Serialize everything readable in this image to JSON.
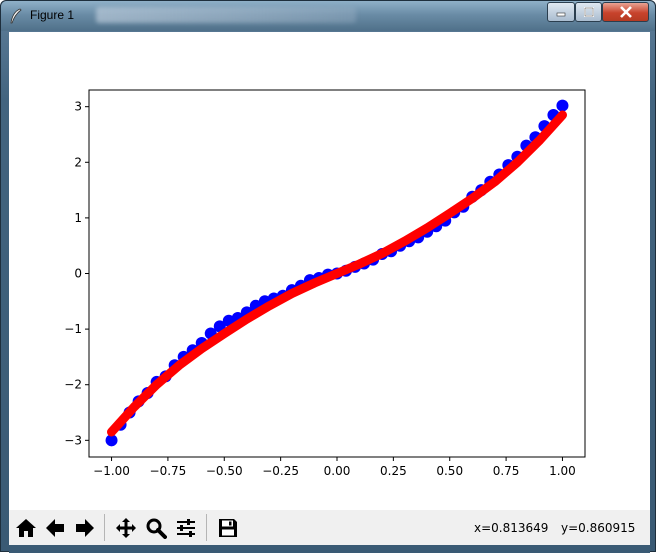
{
  "window": {
    "title": "Figure 1"
  },
  "toolbar": {
    "buttons": [
      "home-icon",
      "back-arrow-icon",
      "forward-arrow-icon",
      "pan-icon",
      "zoom-icon",
      "configure-subplots-icon",
      "save-icon"
    ],
    "coord_x": "x=0.813649",
    "coord_y": "y=0.860915"
  },
  "colors": {
    "scatter": "#0000ff",
    "fit": "#ff0000"
  },
  "chart_data": {
    "type": "scatter",
    "xlim": [
      -1.1,
      1.1
    ],
    "ylim": [
      -3.3,
      3.3
    ],
    "x_ticks": [
      -1.0,
      -0.75,
      -0.5,
      -0.25,
      0.0,
      0.25,
      0.5,
      0.75,
      1.0
    ],
    "x_tick_labels": [
      "−1.00",
      "−0.75",
      "−0.50",
      "−0.25",
      "0.00",
      "0.25",
      "0.50",
      "0.75",
      "1.00"
    ],
    "y_ticks": [
      -3,
      -2,
      -1,
      0,
      1,
      2,
      3
    ],
    "y_tick_labels": [
      "−3",
      "−2",
      "−1",
      "0",
      "1",
      "2",
      "3"
    ],
    "grid": false,
    "series": [
      {
        "kind": "scatter",
        "color": "#0000ff",
        "x": [
          -1.0,
          -0.96,
          -0.92,
          -0.88,
          -0.84,
          -0.8,
          -0.76,
          -0.72,
          -0.68,
          -0.64,
          -0.6,
          -0.56,
          -0.52,
          -0.48,
          -0.44,
          -0.4,
          -0.36,
          -0.32,
          -0.28,
          -0.24,
          -0.2,
          -0.16,
          -0.12,
          -0.08,
          -0.04,
          0.0,
          0.04,
          0.08,
          0.12,
          0.16,
          0.2,
          0.24,
          0.28,
          0.32,
          0.36,
          0.4,
          0.44,
          0.48,
          0.52,
          0.56,
          0.6,
          0.64,
          0.68,
          0.72,
          0.76,
          0.8,
          0.84,
          0.88,
          0.92,
          0.96,
          1.0
        ],
        "y": [
          -3.0,
          -2.72,
          -2.5,
          -2.3,
          -2.15,
          -1.95,
          -1.85,
          -1.65,
          -1.5,
          -1.38,
          -1.25,
          -1.08,
          -0.95,
          -0.85,
          -0.8,
          -0.7,
          -0.58,
          -0.5,
          -0.45,
          -0.4,
          -0.3,
          -0.22,
          -0.12,
          -0.08,
          -0.02,
          0.0,
          0.05,
          0.12,
          0.18,
          0.25,
          0.35,
          0.4,
          0.5,
          0.58,
          0.65,
          0.75,
          0.85,
          0.95,
          1.1,
          1.2,
          1.38,
          1.5,
          1.65,
          1.78,
          1.95,
          2.1,
          2.3,
          2.45,
          2.65,
          2.85,
          3.02
        ]
      },
      {
        "kind": "line",
        "color": "#ff0000",
        "x": [
          -1.0,
          -0.9,
          -0.8,
          -0.7,
          -0.6,
          -0.5,
          -0.4,
          -0.3,
          -0.2,
          -0.1,
          0.0,
          0.1,
          0.2,
          0.3,
          0.4,
          0.5,
          0.6,
          0.7,
          0.8,
          0.9,
          1.0
        ],
        "y": [
          -2.85,
          -2.4,
          -2.0,
          -1.65,
          -1.35,
          -1.08,
          -0.82,
          -0.58,
          -0.36,
          -0.17,
          0.0,
          0.17,
          0.36,
          0.58,
          0.82,
          1.08,
          1.35,
          1.65,
          2.0,
          2.4,
          2.85
        ]
      }
    ]
  }
}
